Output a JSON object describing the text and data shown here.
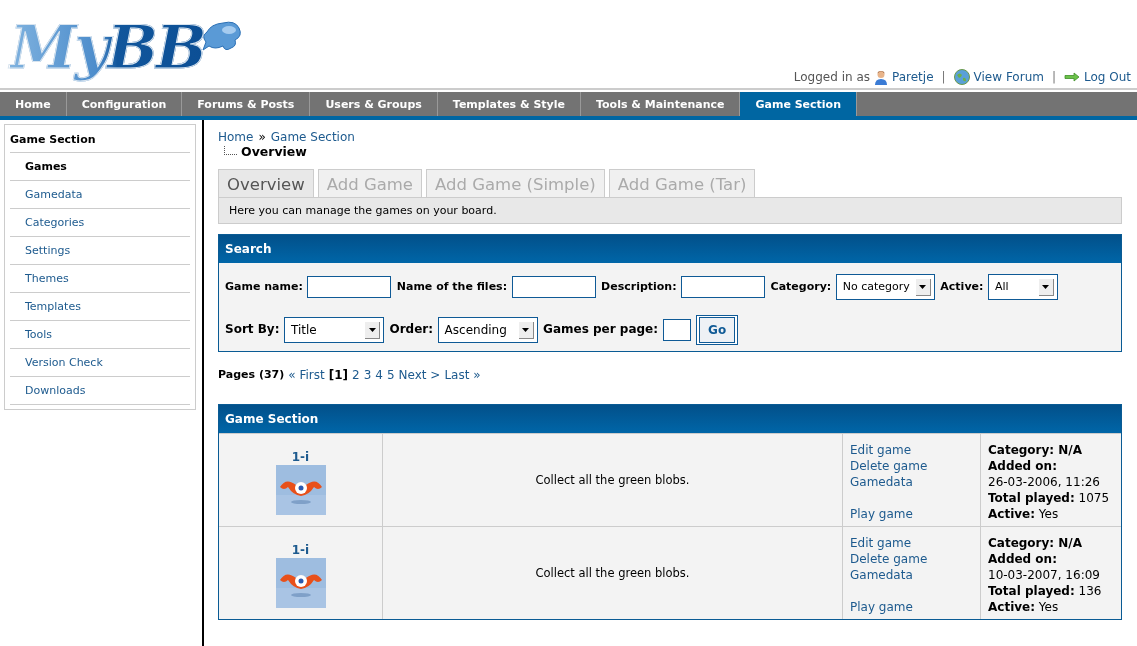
{
  "logo": {
    "text": "MyBB"
  },
  "user_bar": {
    "prefix": "Logged in as",
    "links": [
      {
        "kind": "user",
        "label": "Paretje",
        "separator": "|"
      },
      {
        "kind": "forum",
        "label": "View Forum",
        "separator": "|"
      },
      {
        "kind": "logout",
        "label": "Log Out"
      }
    ]
  },
  "nav_tabs": [
    {
      "label": "Home",
      "selected": false
    },
    {
      "label": "Configuration",
      "selected": false
    },
    {
      "label": "Forums & Posts",
      "selected": false
    },
    {
      "label": "Users & Groups",
      "selected": false
    },
    {
      "label": "Templates & Style",
      "selected": false
    },
    {
      "label": "Tools & Maintenance",
      "selected": false
    },
    {
      "label": "Game Section",
      "selected": true
    }
  ],
  "sidebar": {
    "title": "Game Section",
    "items": [
      {
        "label": "Games",
        "selected": true
      },
      {
        "label": "Gamedata",
        "selected": false
      },
      {
        "label": "Categories",
        "selected": false
      },
      {
        "label": "Settings",
        "selected": false
      },
      {
        "label": "Themes",
        "selected": false
      },
      {
        "label": "Templates",
        "selected": false
      },
      {
        "label": "Tools",
        "selected": false
      },
      {
        "label": "Version Check",
        "selected": false
      },
      {
        "label": "Downloads",
        "selected": false
      }
    ]
  },
  "breadcrumb": {
    "links": [
      "Home",
      "Game Section"
    ],
    "separator": "»",
    "current": "Overview"
  },
  "sub_tabs": [
    {
      "label": "Overview",
      "selected": true
    },
    {
      "label": "Add Game",
      "selected": false
    },
    {
      "label": "Add Game (Simple)",
      "selected": false
    },
    {
      "label": "Add Game (Tar)",
      "selected": false
    }
  ],
  "tab_description": "Here you can manage the games on your board.",
  "search": {
    "title": "Search",
    "filters": [
      {
        "kind": "text",
        "label": "Game name:"
      },
      {
        "kind": "text",
        "label": "Name of the files:"
      },
      {
        "kind": "text",
        "label": "Description:"
      },
      {
        "kind": "select",
        "label": "Category:",
        "value": "No category"
      },
      {
        "kind": "select",
        "label": "Active:",
        "value": "All"
      }
    ],
    "sorting": [
      {
        "kind": "select",
        "label": "Sort By:",
        "value": "Title"
      },
      {
        "kind": "select",
        "label": "Order:",
        "value": "Ascending"
      },
      {
        "kind": "count",
        "label": "Games per page:"
      }
    ],
    "button": "Go"
  },
  "pagination": {
    "label": "Pages (37)",
    "first": "« First",
    "pages": [
      {
        "label": "[1]",
        "selected": true
      },
      {
        "label": "2",
        "selected": false
      },
      {
        "label": "3",
        "selected": false
      },
      {
        "label": "4",
        "selected": false
      },
      {
        "label": "5",
        "selected": false
      }
    ],
    "next": "Next >",
    "last": "Last »"
  },
  "games_table": {
    "title": "Game Section",
    "rows": [
      {
        "name": "1-i",
        "description": "Collect all the green blobs.",
        "actions": [
          "Edit game",
          "Delete game",
          "Gamedata"
        ],
        "play": "Play game",
        "details": [
          {
            "kind": "heading",
            "text": "Category: N/A"
          },
          {
            "kind": "heading",
            "text": "Added on:"
          },
          {
            "kind": "plain",
            "text": "26-03-2006, 11:26"
          },
          {
            "kind": "plain",
            "text": "**Total played:** 1075"
          },
          {
            "kind": "plain",
            "text": "**Active:** Yes"
          }
        ]
      },
      {
        "name": "1-i",
        "description": "Collect all the green blobs.",
        "actions": [
          "Edit game",
          "Delete game",
          "Gamedata"
        ],
        "play": "Play game",
        "details": [
          {
            "kind": "heading",
            "text": "Category: N/A"
          },
          {
            "kind": "heading",
            "text": "Added on:"
          },
          {
            "kind": "plain",
            "text": "10-03-2007, 16:09"
          },
          {
            "kind": "plain",
            "text": "**Total played:** 136"
          },
          {
            "kind": "plain",
            "text": "**Active:** Yes"
          }
        ]
      }
    ]
  }
}
